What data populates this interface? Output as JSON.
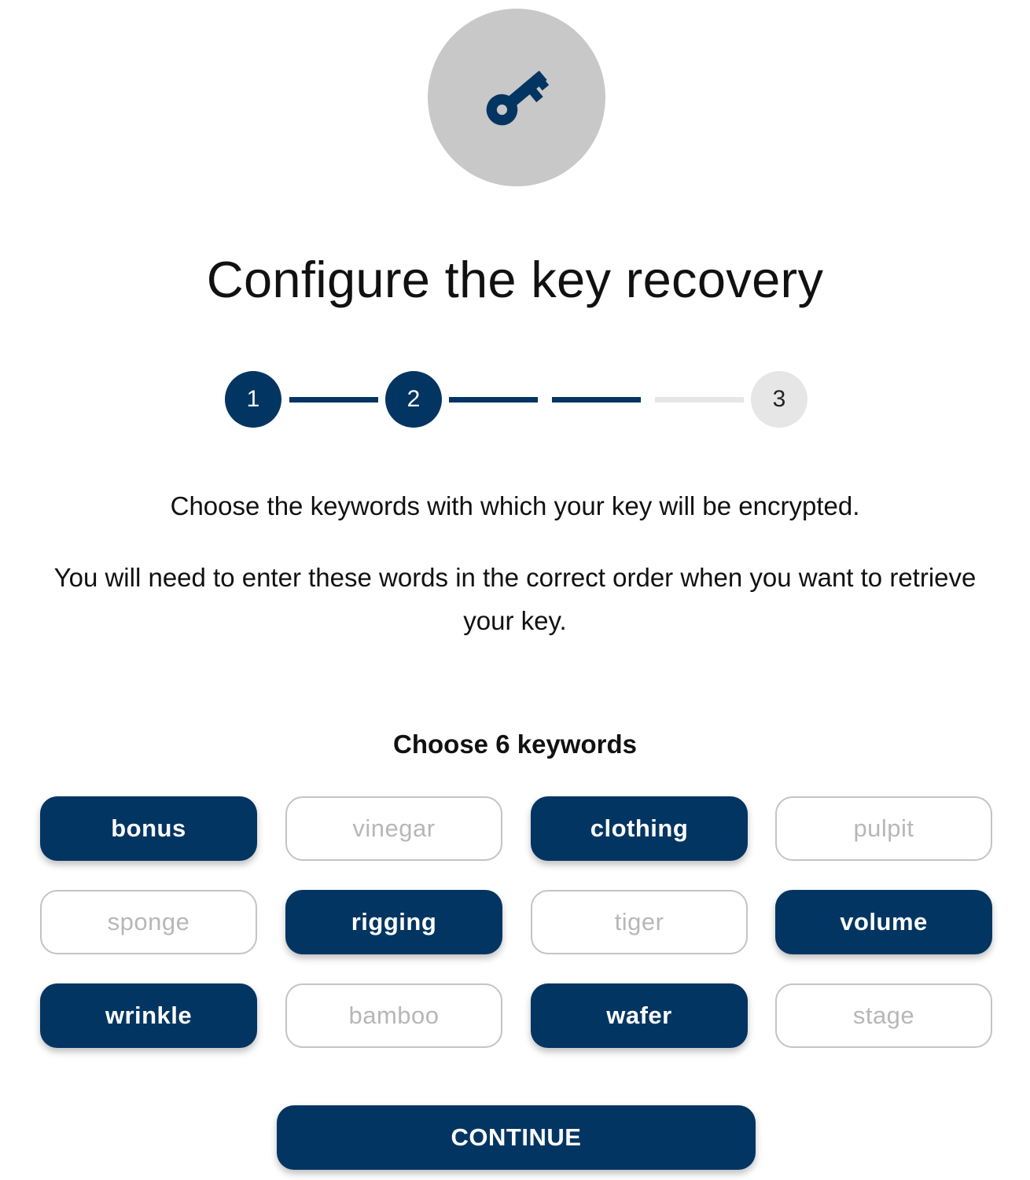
{
  "header": {
    "icon": "key-icon",
    "title": "Configure the key recovery"
  },
  "stepper": {
    "steps": [
      {
        "label": "1",
        "state": "done"
      },
      {
        "label": "2",
        "state": "done"
      },
      {
        "label": "3",
        "state": "todo"
      }
    ]
  },
  "description": {
    "line1": "Choose the keywords with which your key will be encrypted.",
    "line2": "You will need to enter these words in the correct order when you want to retrieve your key."
  },
  "keywords": {
    "title": "Choose 6 keywords",
    "items": [
      {
        "label": "bonus",
        "selected": true
      },
      {
        "label": "vinegar",
        "selected": false
      },
      {
        "label": "clothing",
        "selected": true
      },
      {
        "label": "pulpit",
        "selected": false
      },
      {
        "label": "sponge",
        "selected": false
      },
      {
        "label": "rigging",
        "selected": true
      },
      {
        "label": "tiger",
        "selected": false
      },
      {
        "label": "volume",
        "selected": true
      },
      {
        "label": "wrinkle",
        "selected": true
      },
      {
        "label": "bamboo",
        "selected": false
      },
      {
        "label": "wafer",
        "selected": true
      },
      {
        "label": "stage",
        "selected": false
      }
    ]
  },
  "actions": {
    "continue_label": "CONTINUE"
  },
  "colors": {
    "primary": "#033562",
    "icon_bg": "#c8c8c8",
    "inactive_step": "#e6e6e6",
    "unselected_text": "#b7b7b7"
  }
}
